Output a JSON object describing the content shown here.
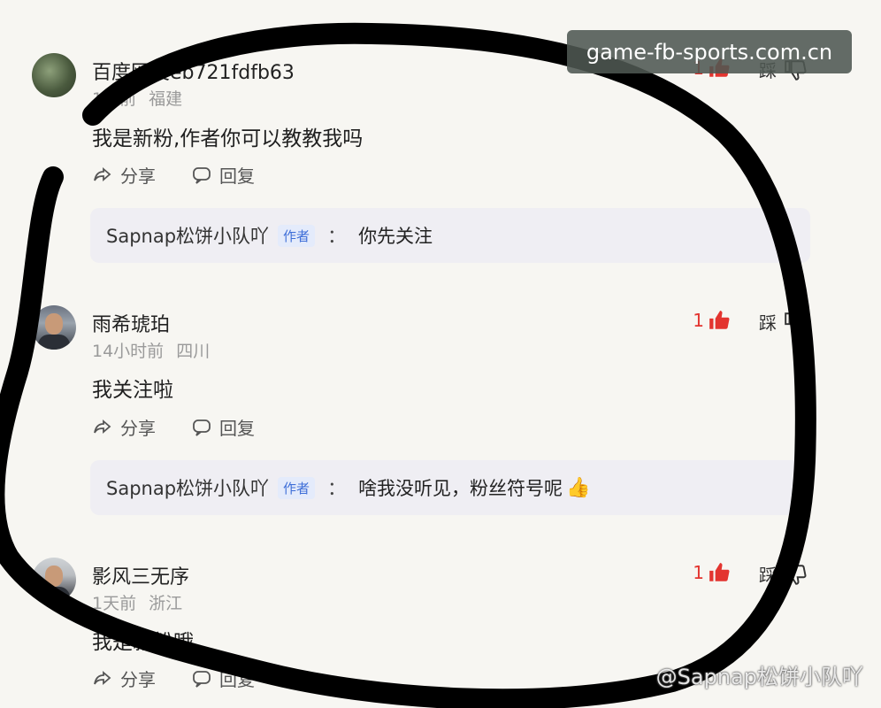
{
  "watermark_top": "game-fb-sports.com.cn",
  "watermark_bottom": "@Sapnap松饼小队吖",
  "actions": {
    "share": "分享",
    "reply": "回复"
  },
  "dislike_label": "踩",
  "author_tag": "作者",
  "comments": [
    {
      "name": "百度网友eb721fdfb63",
      "time": "1天前",
      "location": "福建",
      "text": "我是新粉,作者你可以教教我吗",
      "likes": "1",
      "reply": {
        "author": "Sapnap松饼小队吖",
        "colon": "：",
        "text": "你先关注"
      }
    },
    {
      "name": "雨希琥珀",
      "time": "14小时前",
      "location": "四川",
      "text": "我关注啦",
      "likes": "1",
      "reply": {
        "author": "Sapnap松饼小队吖",
        "colon": "：",
        "text": "啥我没听见，粉丝符号呢"
      }
    },
    {
      "name": "影风三无序",
      "time": "1天前",
      "location": "浙江",
      "text": "我是新粉哦",
      "likes": "1"
    }
  ],
  "colors": {
    "accent_red": "#e3342f",
    "author_blue": "#3f6fd8",
    "scribble": "#000000"
  }
}
